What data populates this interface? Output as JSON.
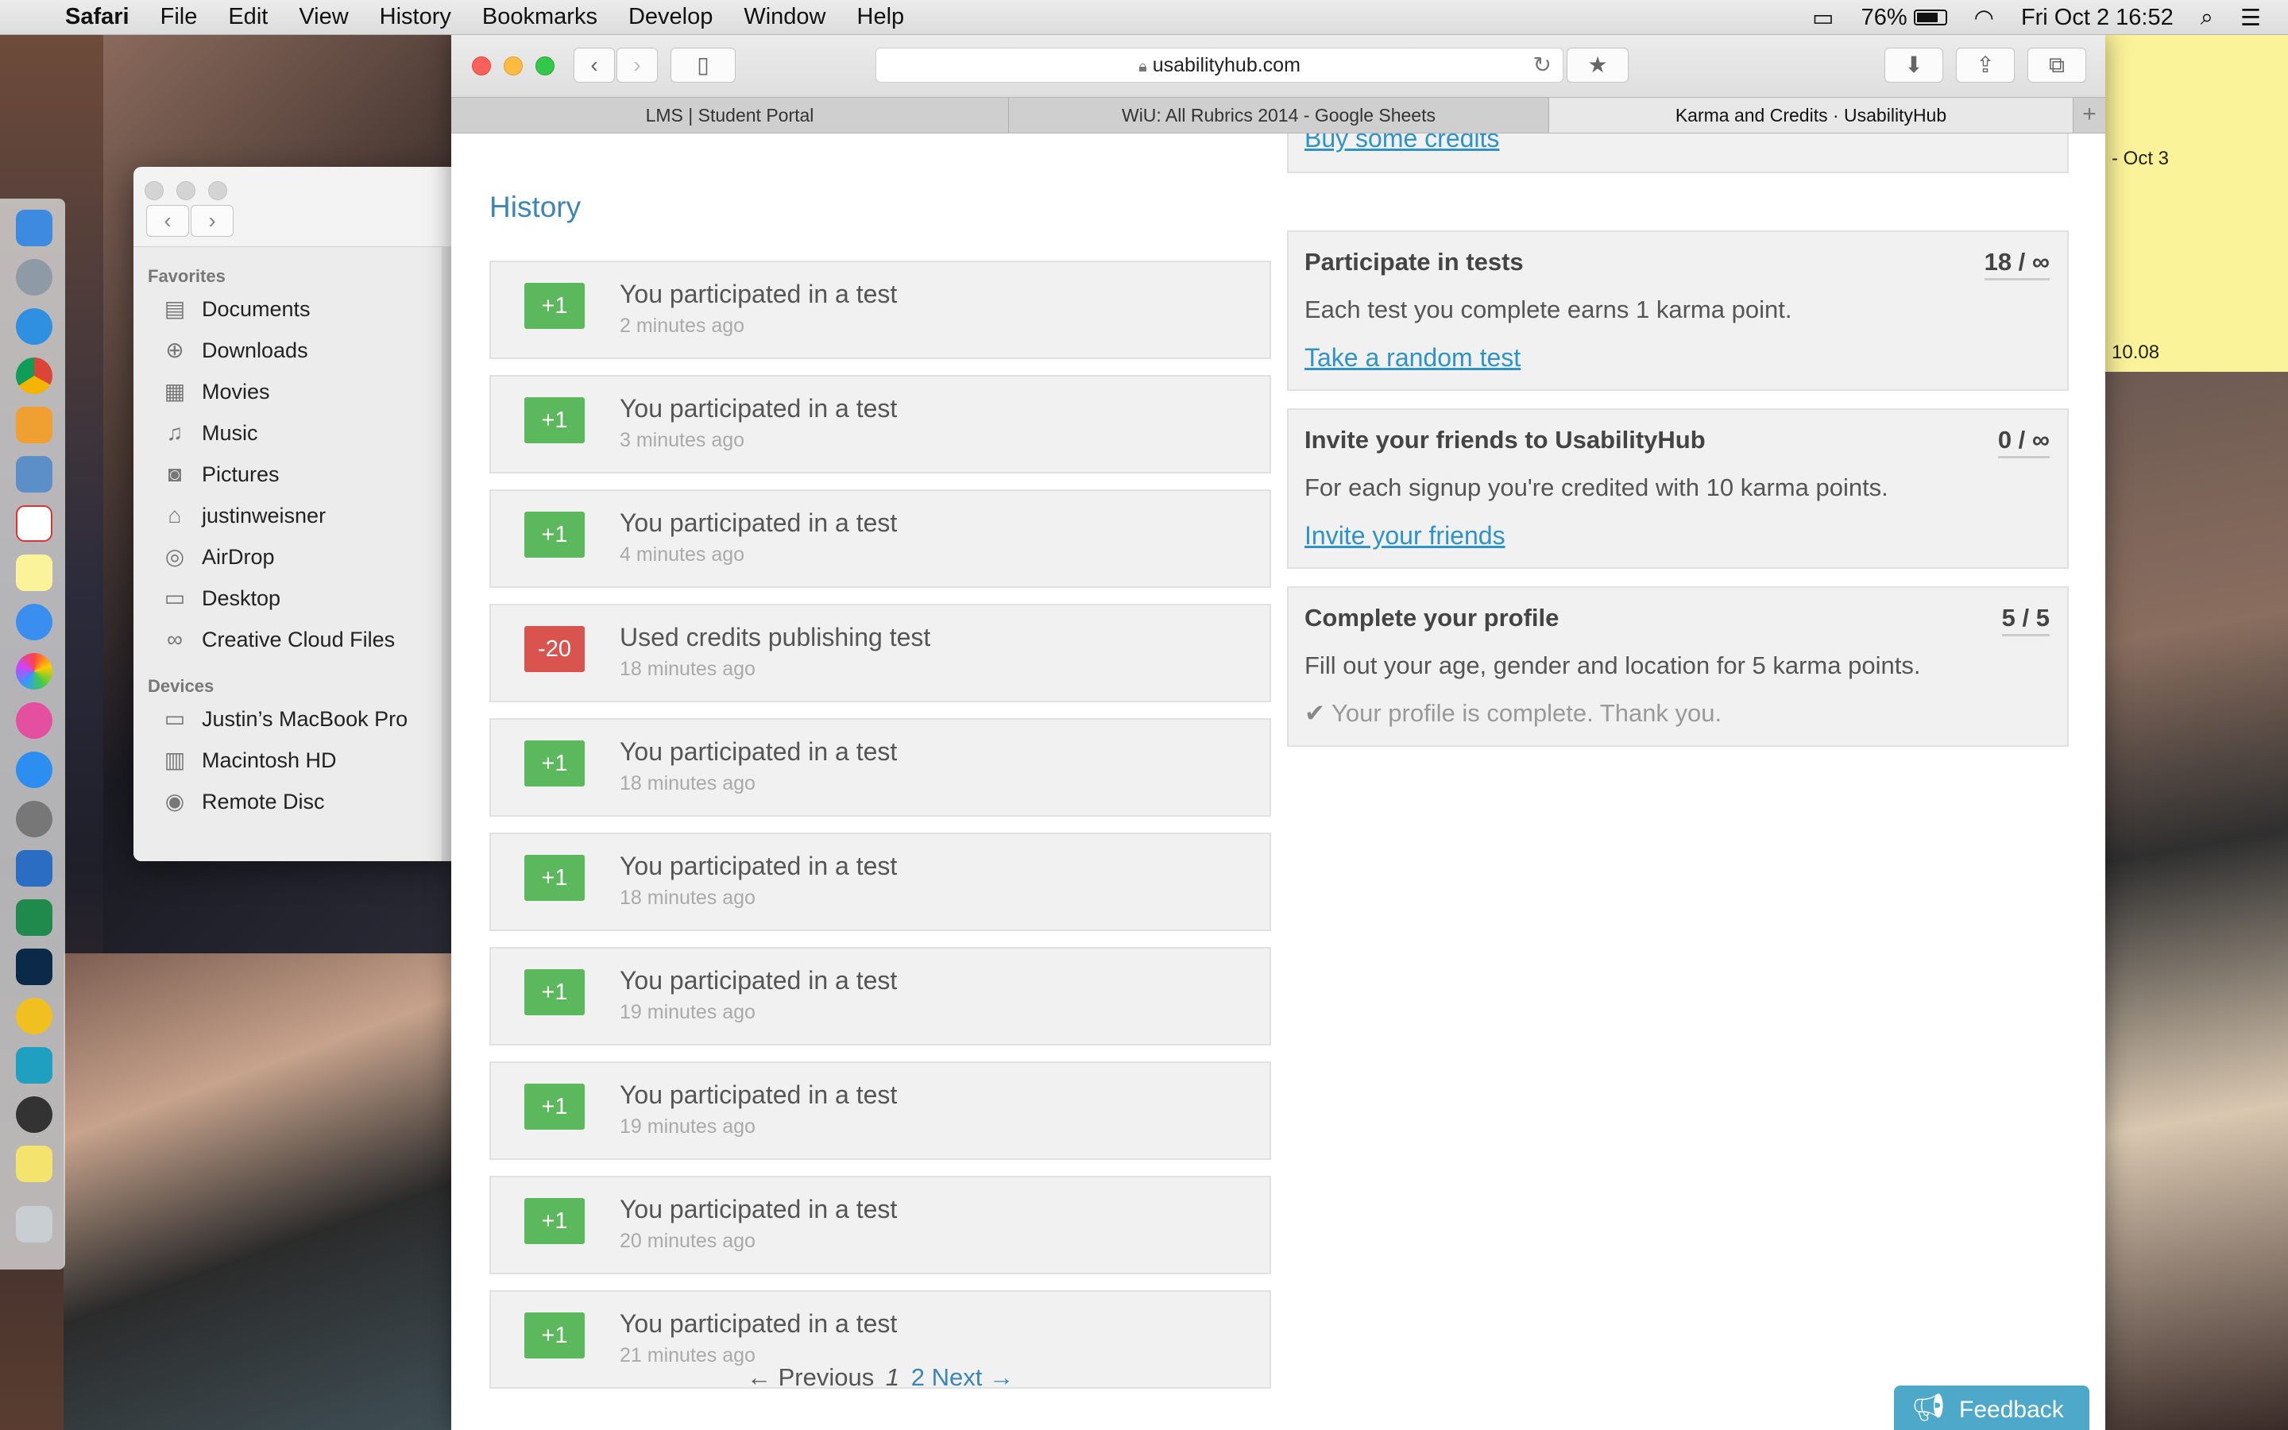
{
  "menubar": {
    "app_name": "Safari",
    "items": [
      "File",
      "Edit",
      "View",
      "History",
      "Bookmarks",
      "Develop",
      "Window",
      "Help"
    ],
    "battery_percent": "76%",
    "datetime": "Fri Oct 2  16:52"
  },
  "finder": {
    "favorites_heading": "Favorites",
    "favorites": [
      {
        "label": "Documents",
        "icon": "documents-icon"
      },
      {
        "label": "Downloads",
        "icon": "downloads-icon"
      },
      {
        "label": "Movies",
        "icon": "movies-icon"
      },
      {
        "label": "Music",
        "icon": "music-icon"
      },
      {
        "label": "Pictures",
        "icon": "pictures-icon"
      },
      {
        "label": "justinweisner",
        "icon": "home-icon"
      },
      {
        "label": "AirDrop",
        "icon": "airdrop-icon"
      },
      {
        "label": "Desktop",
        "icon": "desktop-icon"
      },
      {
        "label": "Creative Cloud Files",
        "icon": "creative-cloud-icon"
      }
    ],
    "devices_heading": "Devices",
    "devices": [
      {
        "label": "Justin’s MacBook Pro",
        "icon": "laptop-icon"
      },
      {
        "label": "Macintosh HD",
        "icon": "hard-disk-icon"
      },
      {
        "label": "Remote Disc",
        "icon": "disc-icon"
      }
    ]
  },
  "browser": {
    "url": "usabilityhub.com",
    "tabs": [
      "LMS | Student Portal",
      "WiU: All Rubrics 2014 - Google Sheets",
      "Karma and Credits · UsabilityHub"
    ],
    "active_tab": 2
  },
  "history": {
    "title": "History",
    "items": [
      {
        "badge": "+1",
        "type": "pos",
        "title": "You participated in a test",
        "time": "2 minutes ago"
      },
      {
        "badge": "+1",
        "type": "pos",
        "title": "You participated in a test",
        "time": "3 minutes ago"
      },
      {
        "badge": "+1",
        "type": "pos",
        "title": "You participated in a test",
        "time": "4 minutes ago"
      },
      {
        "badge": "-20",
        "type": "neg",
        "title": "Used credits publishing test",
        "time": "18 minutes ago"
      },
      {
        "badge": "+1",
        "type": "pos",
        "title": "You participated in a test",
        "time": "18 minutes ago"
      },
      {
        "badge": "+1",
        "type": "pos",
        "title": "You participated in a test",
        "time": "18 minutes ago"
      },
      {
        "badge": "+1",
        "type": "pos",
        "title": "You participated in a test",
        "time": "19 minutes ago"
      },
      {
        "badge": "+1",
        "type": "pos",
        "title": "You participated in a test",
        "time": "19 minutes ago"
      },
      {
        "badge": "+1",
        "type": "pos",
        "title": "You participated in a test",
        "time": "20 minutes ago"
      },
      {
        "badge": "+1",
        "type": "pos",
        "title": "You participated in a test",
        "time": "21 minutes ago"
      }
    ],
    "pagination": {
      "previous": "← Previous",
      "current": "1",
      "next_page": "2",
      "next": "Next →"
    }
  },
  "earn": {
    "buy_link": "Buy some credits",
    "cards": [
      {
        "title": "Participate in tests",
        "count": "18 / ∞",
        "desc": "Each test you complete earns 1 karma point.",
        "link": "Take a random test"
      },
      {
        "title": "Invite your friends to UsabilityHub",
        "count": "0 / ∞",
        "desc": "For each signup you're credited with 10 karma points.",
        "link": "Invite your friends"
      },
      {
        "title": "Complete your profile",
        "count": "5 / 5",
        "desc": "Fill out your age, gender and location for 5 karma points.",
        "done": "Your profile is complete. Thank you."
      }
    ]
  },
  "feedback": {
    "label": "Feedback"
  },
  "sticky": {
    "lines": [
      "- Oct 3",
      "10.08"
    ]
  },
  "colors": {
    "accent": "#3b86b7",
    "positive": "#5cb85c",
    "negative": "#d9534f",
    "link": "#2f93c8",
    "feedback": "#4ea8c9"
  }
}
